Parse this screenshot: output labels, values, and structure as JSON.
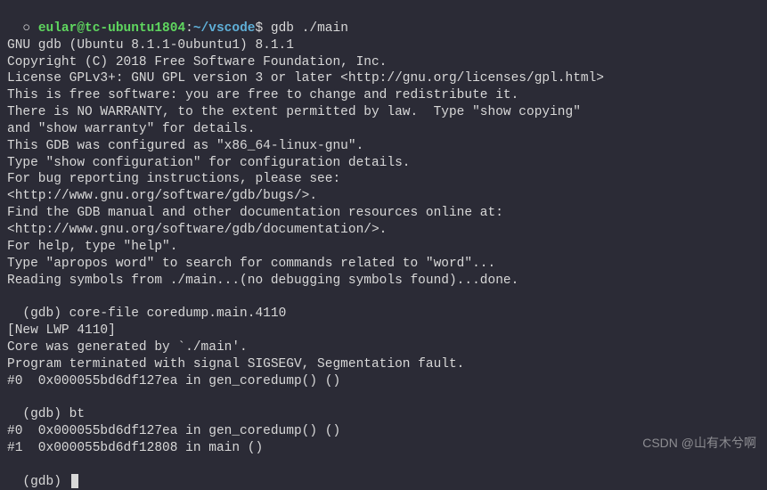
{
  "prompt": {
    "bullet": "○ ",
    "user": "eular",
    "at": "@",
    "host": "tc-ubuntu1804",
    "colon": ":",
    "path": "~/vscode",
    "dollar": "$ ",
    "command": "gdb ./main"
  },
  "output": {
    "l0": "GNU gdb (Ubuntu 8.1.1-0ubuntu1) 8.1.1",
    "l1": "Copyright (C) 2018 Free Software Foundation, Inc.",
    "l2": "License GPLv3+: GNU GPL version 3 or later <http://gnu.org/licenses/gpl.html>",
    "l3": "This is free software: you are free to change and redistribute it.",
    "l4": "There is NO WARRANTY, to the extent permitted by law.  Type \"show copying\"",
    "l5": "and \"show warranty\" for details.",
    "l6": "This GDB was configured as \"x86_64-linux-gnu\".",
    "l7": "Type \"show configuration\" for configuration details.",
    "l8": "For bug reporting instructions, please see:",
    "l9": "<http://www.gnu.org/software/gdb/bugs/>.",
    "l10": "Find the GDB manual and other documentation resources online at:",
    "l11": "<http://www.gnu.org/software/gdb/documentation/>.",
    "l12": "For help, type \"help\".",
    "l13": "Type \"apropos word\" to search for commands related to \"word\"...",
    "l14": "Reading symbols from ./main...(no debugging symbols found)...done."
  },
  "gdb": {
    "cmd1_prompt": "(gdb) ",
    "cmd1": "core-file coredump.main.4110",
    "o1": "[New LWP 4110]",
    "o2": "Core was generated by `./main'.",
    "o3": "Program terminated with signal SIGSEGV, Segmentation fault.",
    "o4": "#0  0x000055bd6df127ea in gen_coredump() ()",
    "cmd2_prompt": "(gdb) ",
    "cmd2": "bt",
    "o5": "#0  0x000055bd6df127ea in gen_coredump() ()",
    "o6": "#1  0x000055bd6df12808 in main ()",
    "cmd3_prompt": "(gdb) "
  },
  "watermark": "CSDN @山有木兮啊"
}
